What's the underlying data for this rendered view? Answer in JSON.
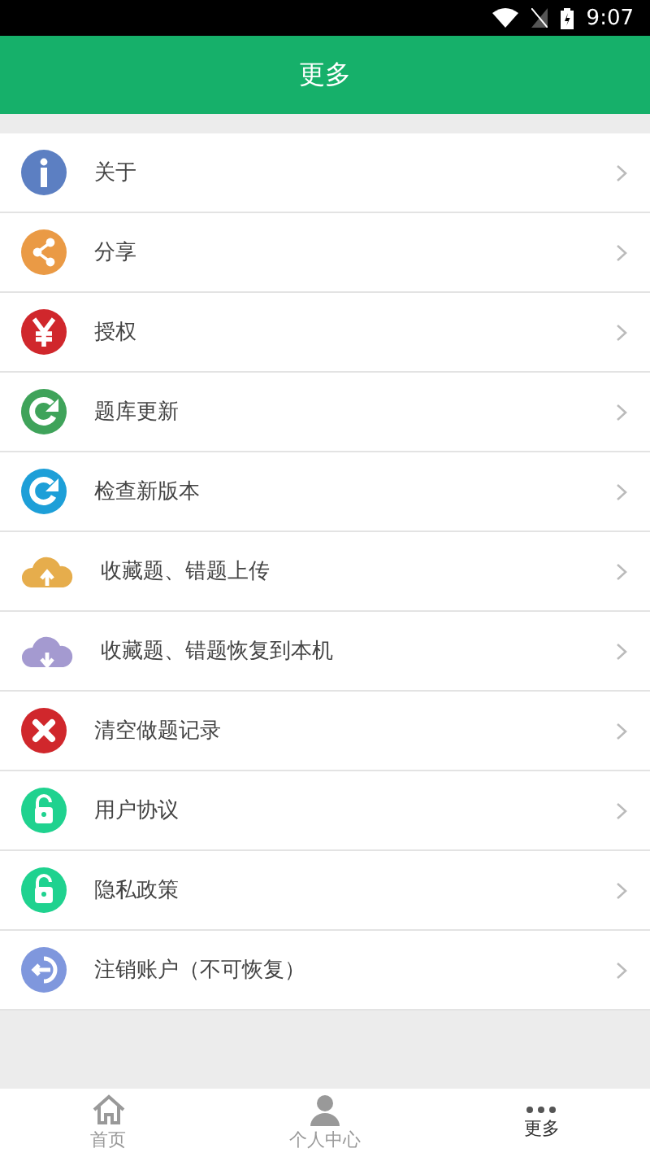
{
  "status_bar": {
    "time": "9:07"
  },
  "header": {
    "title": "更多"
  },
  "items": [
    {
      "kind": "info",
      "label": "关于"
    },
    {
      "kind": "share",
      "label": "分享"
    },
    {
      "kind": "yen",
      "label": "授权"
    },
    {
      "kind": "refresh-green",
      "label": "题库更新"
    },
    {
      "kind": "refresh-blue",
      "label": "检查新版本"
    },
    {
      "kind": "upload",
      "label": "收藏题、错题上传"
    },
    {
      "kind": "download",
      "label": "收藏题、错题恢复到本机"
    },
    {
      "kind": "clear",
      "label": "清空做题记录"
    },
    {
      "kind": "lock",
      "label": "用户协议"
    },
    {
      "kind": "lock",
      "label": "隐私政策"
    },
    {
      "kind": "logout",
      "label": "注销账户（不可恢复）"
    }
  ],
  "tabs": [
    {
      "kind": "home",
      "label": "首页",
      "selected": false
    },
    {
      "kind": "person",
      "label": "个人中心",
      "selected": false
    },
    {
      "kind": "more",
      "label": "更多",
      "selected": true
    }
  ]
}
